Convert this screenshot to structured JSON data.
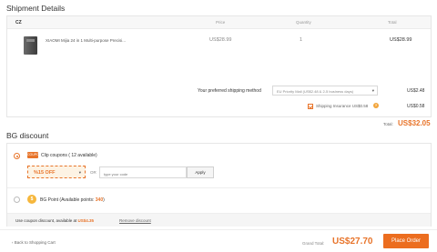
{
  "shipment": {
    "title": "Shipment Details",
    "warehouse": "CZ",
    "columns": {
      "price": "Price",
      "quantity": "Quantity",
      "total": "Total"
    },
    "product": {
      "name": "XIAOMI Mijia 24 in 1 Multi-purpose Precisi...",
      "price": "US$28.99",
      "quantity": "1",
      "total": "US$28.99",
      "image_icon": "product-thumbnail"
    },
    "shipping": {
      "label": "Your preferred shipping method",
      "selected": "EU Priority Mail (US$2.48 & 2-5 business days)",
      "cost": "US$2.48"
    },
    "insurance": {
      "label": "Shipping Insurance  US$0.58",
      "help": "?",
      "cost": "US$0.58",
      "checked": true
    },
    "total_label": "Total:",
    "total_value": "US$32.05"
  },
  "bg_discount": {
    "title": "BG discount",
    "coupons_icon": "coupon-icon",
    "coupons_icon_text": "COUPON",
    "coupons_label": "Clip coupons ( 12 available)",
    "coupon_selected": "%15 OFF",
    "or_label": "OR",
    "code_placeholder": "type your code",
    "apply_label": "Apply",
    "point_icon": "$",
    "point_label": "BG Point (Available points:",
    "point_count": "340",
    "point_close": ")",
    "discount_text": "Use coupon discount, available at ",
    "discount_amount": "US$4.35",
    "remove_label": "Remove discount"
  },
  "footer": {
    "back_label": "Back to Shopping Cart",
    "grand_label": "Grand Total:",
    "grand_value": "US$27.70",
    "place_label": "Place Order"
  },
  "colors": {
    "accent": "#e8742a",
    "button": "#ec6d1f"
  }
}
